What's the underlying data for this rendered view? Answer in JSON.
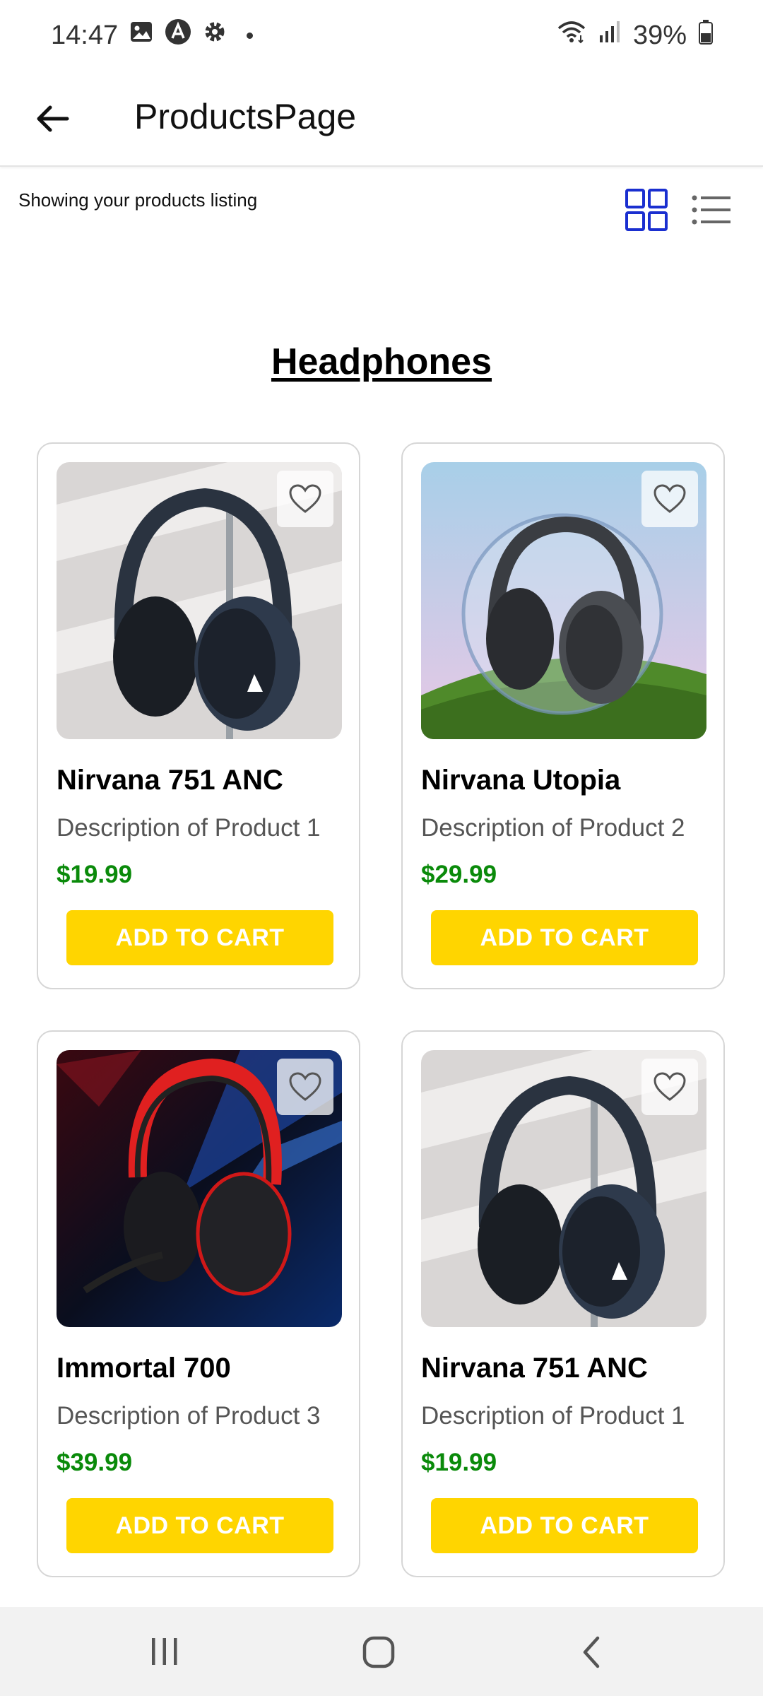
{
  "status_bar": {
    "time": "14:47",
    "battery": "39%",
    "icons_left": [
      "gallery-icon",
      "a-icon",
      "gear-icon",
      "dot"
    ],
    "icons_right": [
      "wifi-icon",
      "signal-icon",
      "battery-icon"
    ]
  },
  "app_bar": {
    "title": "ProductsPage",
    "back_icon": "arrow-left-icon"
  },
  "listing": {
    "label": "Showing your products listing",
    "grid_view_icon": "grid-view-icon",
    "list_view_icon": "list-view-icon",
    "active_view": "grid"
  },
  "section": {
    "title": "Headphones"
  },
  "products": [
    {
      "name": "Nirvana 751 ANC",
      "description": "Description of Product 1",
      "price": "$19.99",
      "button": "ADD TO CART"
    },
    {
      "name": "Nirvana Utopia",
      "description": "Description of Product 2",
      "price": "$29.99",
      "button": "ADD TO CART"
    },
    {
      "name": "Immortal 700",
      "description": "Description of Product 3",
      "price": "$39.99",
      "button": "ADD TO CART"
    },
    {
      "name": "Nirvana 751 ANC",
      "description": "Description of Product 1",
      "price": "$19.99",
      "button": "ADD TO CART"
    }
  ],
  "colors": {
    "accent_blue": "#1a2fd0",
    "price_green": "#0a8a0a",
    "button_yellow": "#ffd500"
  },
  "nav_bar": {
    "icons": [
      "recents-icon",
      "home-icon",
      "back-icon"
    ]
  }
}
